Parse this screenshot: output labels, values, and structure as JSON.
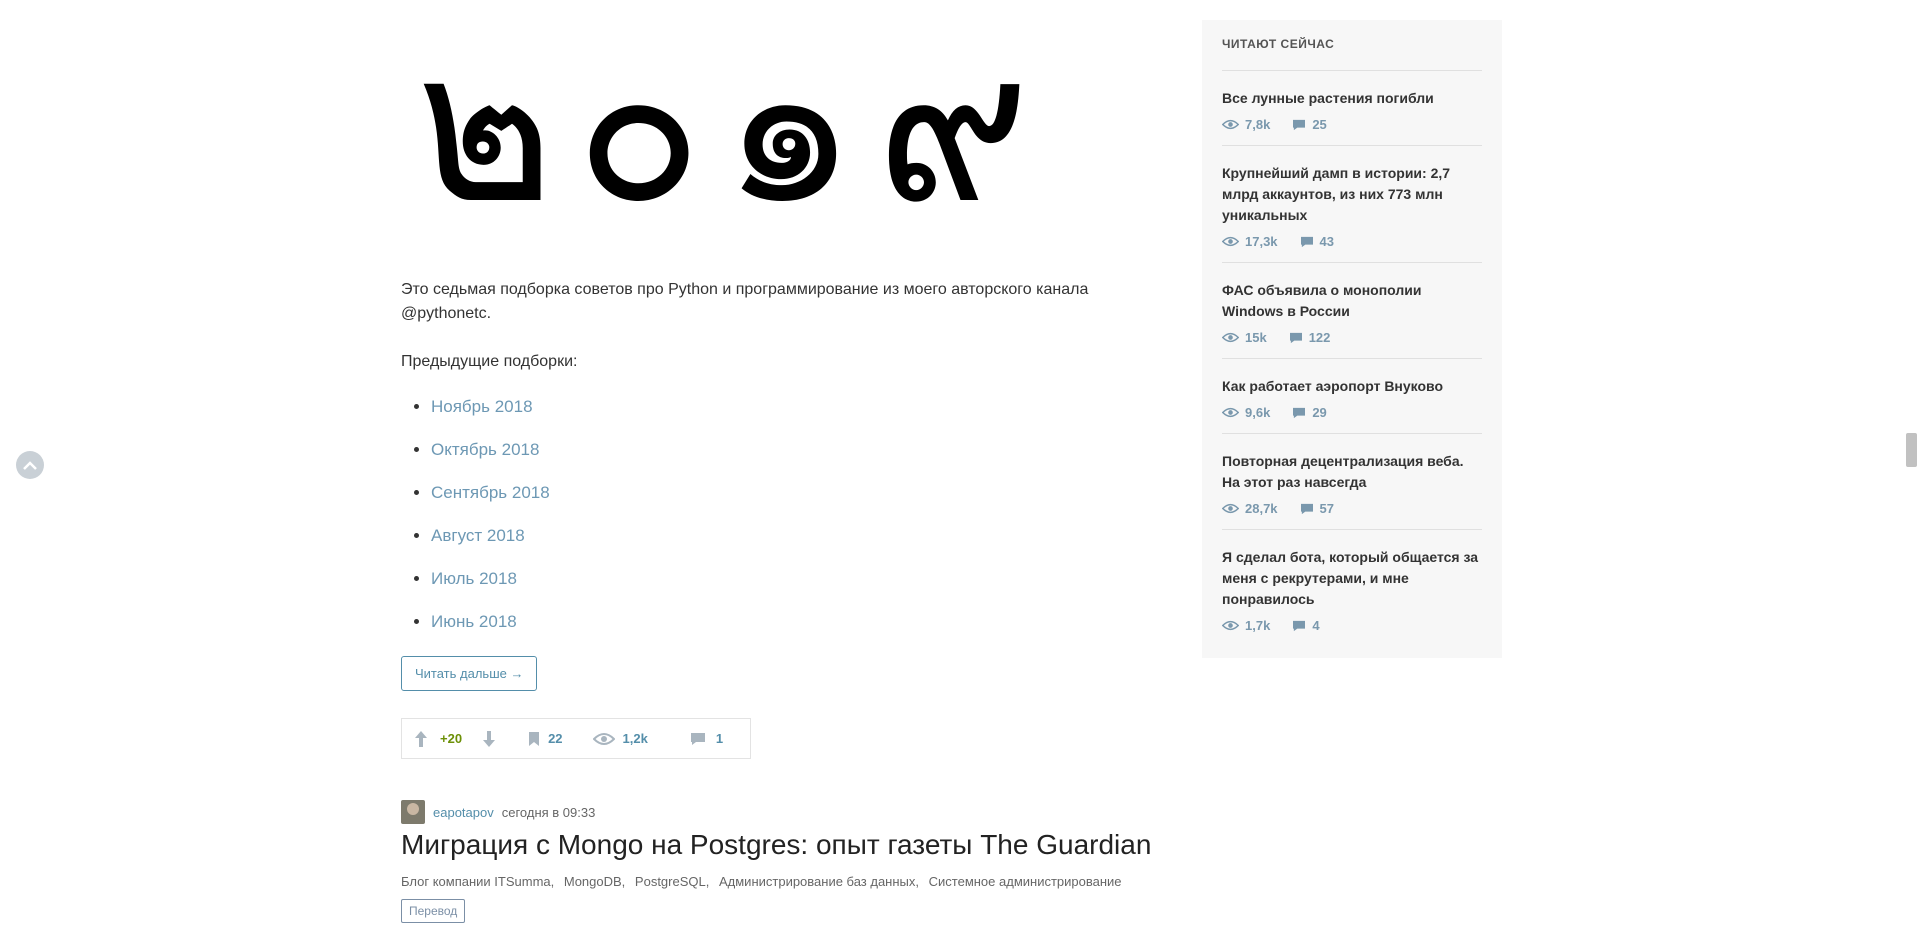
{
  "hero": {
    "text": "๒๐๑๙"
  },
  "article": {
    "intro_pre": "Это седьмая подборка советов про Python и программирование из моего авторского канала",
    "intro_link": "@pythonetc",
    "intro_post": ".",
    "previous_label": "Предыдущие подборки:",
    "previous_links": [
      "Ноябрь 2018",
      "Октябрь 2018",
      "Сентябрь 2018",
      "Август 2018",
      "Июль 2018",
      "Июнь 2018"
    ],
    "read_more": "Читать дальше →",
    "stats": {
      "score": "+20",
      "bookmarks": "22",
      "views": "1,2k",
      "comments": "1"
    }
  },
  "next_post": {
    "author": "eapotapov",
    "time": "сегодня в 09:33",
    "title": "Миграция с Mongo на Postgres: опыт газеты The Guardian",
    "hubs": [
      "Блог компании ITSumma,",
      "MongoDB,",
      "PostgreSQL,",
      "Администрирование баз данных,",
      "Системное администрирование"
    ],
    "tag": "Перевод"
  },
  "sidebar": {
    "title": "ЧИТАЮТ СЕЙЧАС",
    "items": [
      {
        "title": "Все лунные растения погибли",
        "views": "7,8k",
        "comments": "25"
      },
      {
        "title": "Крупнейший дамп в истории: 2,7 млрд аккаунтов, из них 773 млн уникальных",
        "views": "17,3k",
        "comments": "43"
      },
      {
        "title": "ФАС объявила о монополии Windows в России",
        "views": "15k",
        "comments": "122"
      },
      {
        "title": "Как работает аэропорт Внуково",
        "views": "9,6k",
        "comments": "29"
      },
      {
        "title": "Повторная децентрализация веба. На этот раз навсегда",
        "views": "28,7k",
        "comments": "57"
      },
      {
        "title": "Я сделал бота, который общается за меня с рекрутерами, и мне понравилось",
        "views": "1,7k",
        "comments": "4"
      }
    ]
  }
}
